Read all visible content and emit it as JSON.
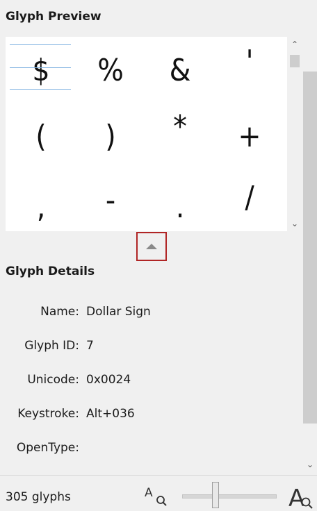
{
  "preview": {
    "title": "Glyph Preview",
    "glyphs": [
      "$",
      "%",
      "&",
      "'",
      "(",
      ")",
      "*",
      "+",
      ",",
      "-",
      ".",
      "/"
    ]
  },
  "details": {
    "title": "Glyph Details",
    "rows": [
      {
        "label": "Name:",
        "value": "Dollar Sign"
      },
      {
        "label": "Glyph ID:",
        "value": "7"
      },
      {
        "label": "Unicode:",
        "value": "0x0024"
      },
      {
        "label": "Keystroke:",
        "value": "Alt+036"
      },
      {
        "label": "OpenType:",
        "value": ""
      }
    ]
  },
  "status": {
    "glyph_count": "305 glyphs"
  },
  "colors": {
    "highlight": "#b02525",
    "guide": "#7fb2e0"
  },
  "icons": {
    "collapse": "triangle-up-icon",
    "zoom_out": "zoom-out-icon",
    "zoom_in": "zoom-in-icon"
  }
}
